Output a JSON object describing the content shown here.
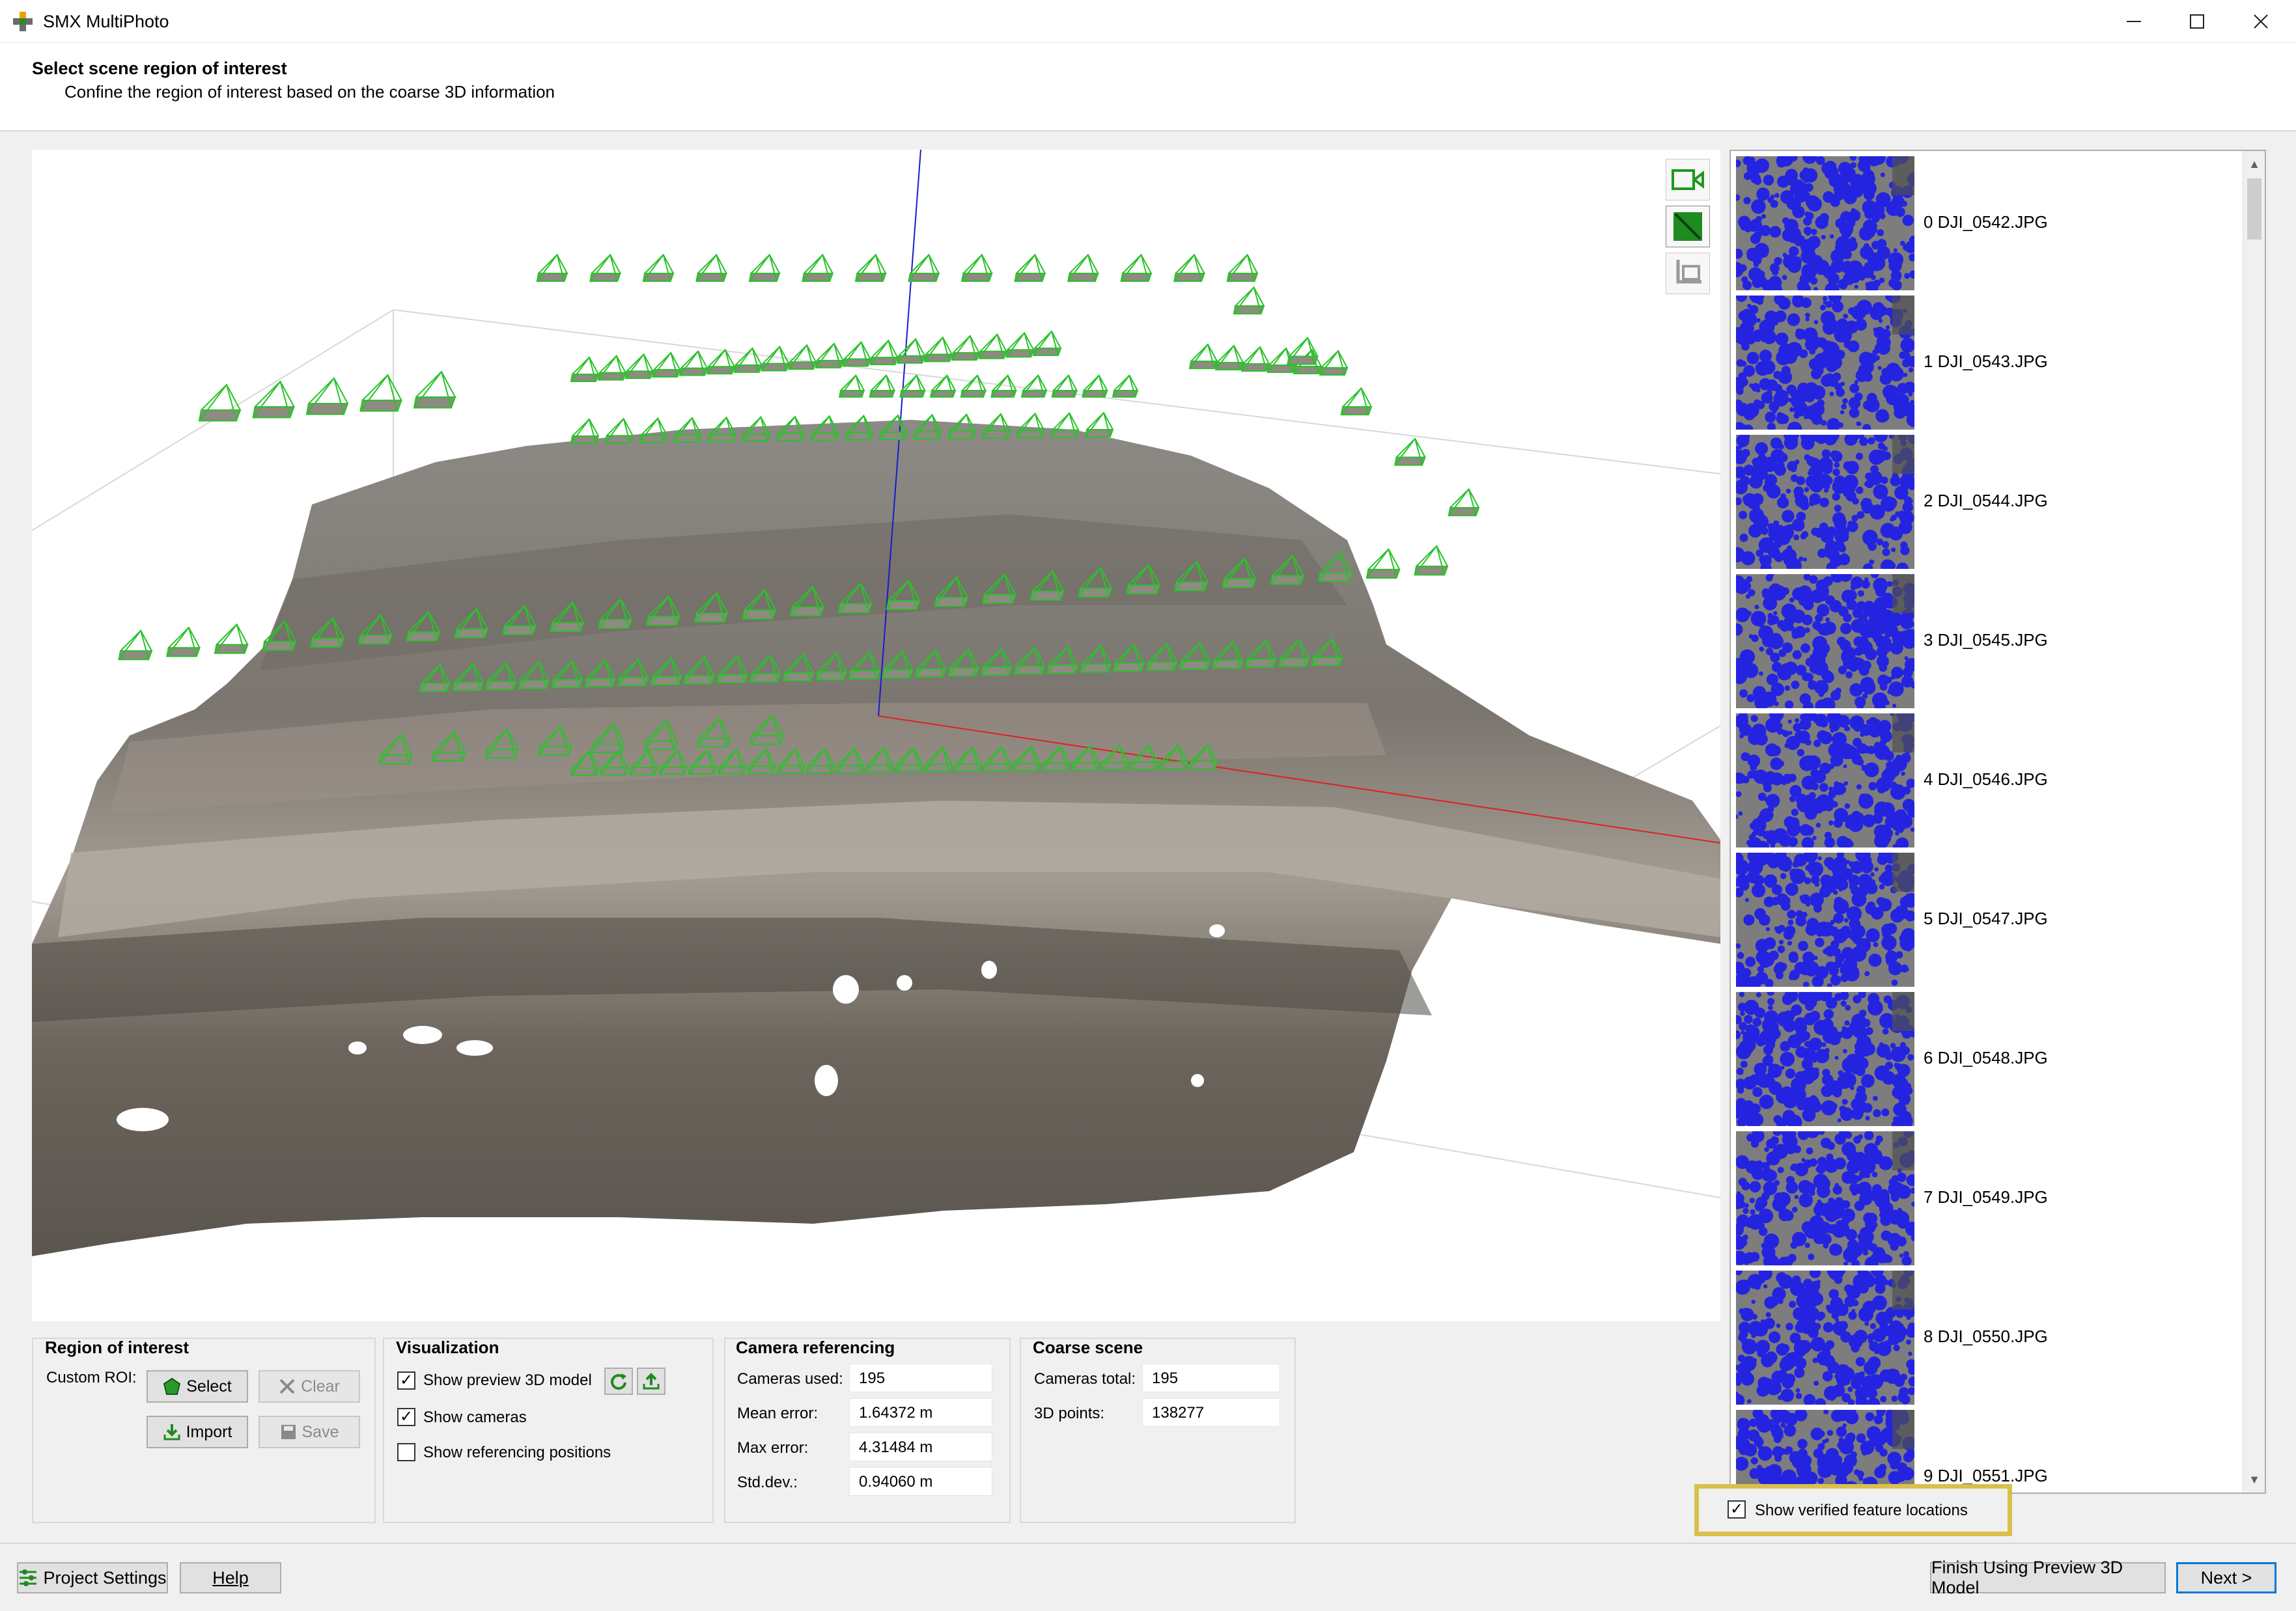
{
  "window": {
    "title": "SMX MultiPhoto"
  },
  "header": {
    "title": "Select scene region of interest",
    "subtitle": "Confine the region of interest based on the coarse 3D information"
  },
  "thumbnails": [
    {
      "label": "0 DJI_0542.JPG"
    },
    {
      "label": "1 DJI_0543.JPG"
    },
    {
      "label": "2 DJI_0544.JPG"
    },
    {
      "label": "3 DJI_0545.JPG"
    },
    {
      "label": "4 DJI_0546.JPG"
    },
    {
      "label": "5 DJI_0547.JPG"
    },
    {
      "label": "6 DJI_0548.JPG"
    },
    {
      "label": "7 DJI_0549.JPG"
    },
    {
      "label": "8 DJI_0550.JPG"
    },
    {
      "label": "9 DJI_0551.JPG"
    }
  ],
  "verified": {
    "label": "Show verified feature locations",
    "checked": true
  },
  "roi": {
    "title": "Region of interest",
    "custom_label": "Custom ROI:",
    "select": "Select",
    "clear": "Clear",
    "import": "Import",
    "save": "Save"
  },
  "visualization": {
    "title": "Visualization",
    "preview": "Show preview 3D model",
    "cameras": "Show cameras",
    "referencing": "Show referencing positions"
  },
  "camera_ref": {
    "title": "Camera referencing",
    "rows": [
      {
        "label": "Cameras used:",
        "value": "195"
      },
      {
        "label": "Mean error:",
        "value": "1.64372 m"
      },
      {
        "label": "Max error:",
        "value": "4.31484 m"
      },
      {
        "label": "Std.dev.:",
        "value": "0.94060 m"
      }
    ]
  },
  "coarse": {
    "title": "Coarse scene",
    "rows": [
      {
        "label": "Cameras total:",
        "value": "195"
      },
      {
        "label": "3D points:",
        "value": "138277"
      }
    ]
  },
  "footer": {
    "project_settings": "Project Settings",
    "help": "Help",
    "finish": "Finish Using Preview 3D Model",
    "next": "Next >"
  }
}
